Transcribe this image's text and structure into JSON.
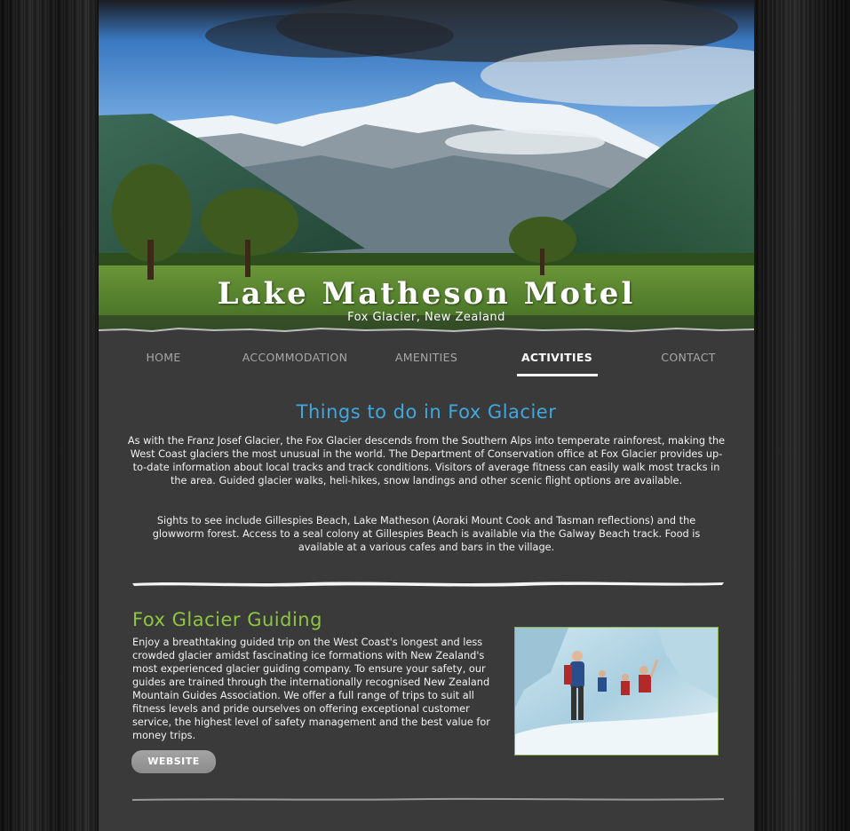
{
  "header": {
    "title": "Lake Matheson Motel",
    "subtitle": "Fox Glacier, New Zealand"
  },
  "nav": {
    "items": [
      {
        "label": "HOME",
        "active": false
      },
      {
        "label": "ACCOMMODATION",
        "active": false
      },
      {
        "label": "AMENITIES",
        "active": false
      },
      {
        "label": "ACTIVITIES",
        "active": true
      },
      {
        "label": "CONTACT",
        "active": false
      }
    ]
  },
  "main": {
    "title": "Things to do in Fox Glacier",
    "paragraphs": [
      "As with the Franz Josef Glacier, the Fox Glacier descends from the Southern Alps into temperate rainforest, making the West Coast glaciers the most unusual in the world. The Department of Conservation office at Fox Glacier provides up-to-date information about local tracks and track conditions. Visitors of average fitness can easily walk most tracks in the area. Guided glacier walks, heli-hikes, snow landings and other scenic flight options are available.",
      "Sights to see include Gillespies Beach, Lake Matheson (Aoraki Mount Cook and Tasman reflections) and the glowworm forest. Access to a seal colony at Gillespies Beach is available via the Galway Beach track. Food is available at a various cafes and bars in the village."
    ]
  },
  "section": {
    "title": "Fox Glacier Guiding",
    "text": "Enjoy a breathtaking guided trip on the West Coast's longest and less crowded glacier amidst fascinating ice formations with New Zealand's most experienced glacier guiding company. To ensure your safety, our guides are trained through the internationally recognised New Zealand Mountain Guides Association. We offer a full range of trips to suit all fitness levels and pride ourselves on offering exceptional customer service, the highest level of safety management and the best value for money trips.",
    "button_label": "WEBSITE"
  },
  "colors": {
    "title_blue": "#3fa8e0",
    "section_green": "#8dc63f",
    "page_bg": "#3a3a3b"
  }
}
